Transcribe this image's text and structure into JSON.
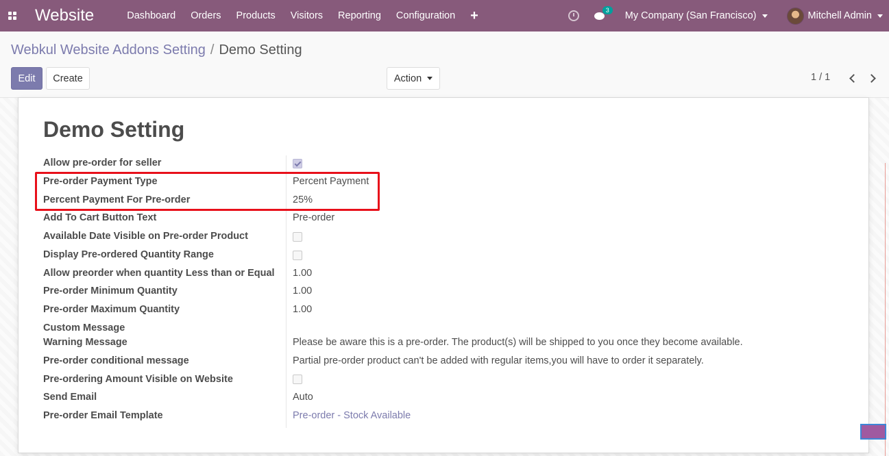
{
  "navbar": {
    "brand": "Website",
    "menu": [
      "Dashboard",
      "Orders",
      "Products",
      "Visitors",
      "Reporting",
      "Configuration"
    ],
    "plus_icon": "+",
    "chat_count": "3",
    "company": "My Company (San Francisco)",
    "user": "Mitchell Admin",
    "bg_color": "#875a7b"
  },
  "breadcrumb": {
    "parent": "Webkul Website Addons Setting",
    "separator": "/",
    "current": "Demo Setting"
  },
  "controls": {
    "edit": "Edit",
    "create": "Create",
    "action": "Action",
    "pager": "1 / 1"
  },
  "form": {
    "title": "Demo Setting",
    "rows": [
      {
        "label": "Allow pre-order for seller",
        "type": "checkbox",
        "checked": true
      },
      {
        "label": "Pre-order Payment Type",
        "type": "text",
        "value": "Percent Payment"
      },
      {
        "label": "Percent Payment For Pre-order",
        "type": "text",
        "value": "25%"
      },
      {
        "label": "Add To Cart Button Text",
        "type": "text",
        "value": "Pre-order"
      },
      {
        "label": "Available Date Visible on Pre-order Product",
        "type": "checkbox",
        "checked": false
      },
      {
        "label": "Display Pre-ordered Quantity Range",
        "type": "checkbox",
        "checked": false
      },
      {
        "label": "Allow preorder when quantity Less than or Equal",
        "type": "text",
        "value": "1.00"
      },
      {
        "label": "Pre-order Minimum Quantity",
        "type": "text",
        "value": "1.00"
      },
      {
        "label": "Pre-order Maximum Quantity",
        "type": "text",
        "value": "1.00"
      },
      {
        "label": "Custom Message",
        "type": "none"
      },
      {
        "label": "Warning Message",
        "type": "text",
        "value": "Please be aware this is a pre-order. The product(s) will be shipped to you once they become available."
      },
      {
        "label": "Pre-order conditional message",
        "type": "text",
        "value": "Partial pre-order product can't be added with regular items,you will have to order it separately."
      },
      {
        "label": "Pre-ordering Amount Visible on Website",
        "type": "checkbox",
        "checked": false
      },
      {
        "label": "Send Email",
        "type": "text",
        "value": "Auto"
      },
      {
        "label": "Pre-order Email Template",
        "type": "link",
        "value": "Pre-order - Stock Available"
      }
    ]
  }
}
